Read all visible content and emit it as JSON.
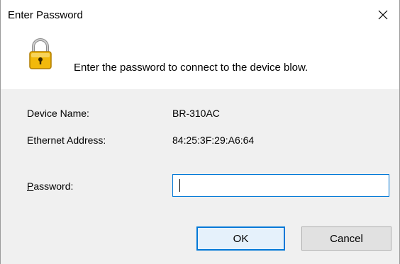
{
  "window": {
    "title": "Enter Password",
    "close_glyph": "✕"
  },
  "header": {
    "icon": "lock-icon",
    "message": "Enter the password to connect to the device blow."
  },
  "device": {
    "name_label": "Device Name:",
    "name_value": "BR-310AC",
    "ethernet_label": "Ethernet Address:",
    "ethernet_value": "84:25:3F:29:A6:64"
  },
  "password": {
    "label_mnemonic": "P",
    "label_rest": "assword:",
    "value": ""
  },
  "buttons": {
    "ok_label": "OK",
    "cancel_label": "Cancel"
  },
  "colors": {
    "accent": "#0078d7",
    "lock_gold": "#f2b90c",
    "dialog_bg": "#f0f0f0"
  }
}
